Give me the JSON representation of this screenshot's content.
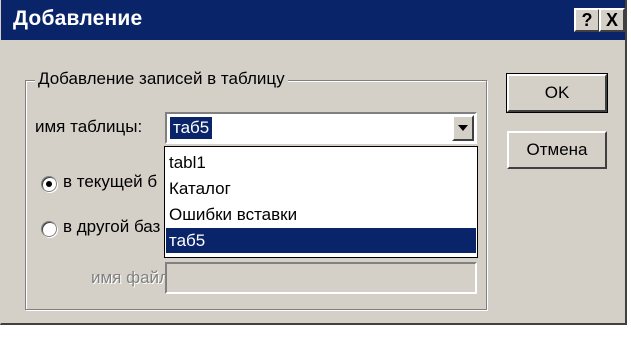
{
  "dialog": {
    "title": "Добавление",
    "help_button": "?",
    "close_button": "X"
  },
  "group": {
    "legend": "Добавление записей в таблицу",
    "table_name_label": "имя таблицы:",
    "table_value": "таб5",
    "radio_current": "в текущей б",
    "radio_other": "в другой баз",
    "file_name_label": "имя файла:"
  },
  "dropdown": {
    "items": [
      "tabl1",
      "Каталог",
      "Ошибки вставки",
      "таб5"
    ],
    "selected_index": 3
  },
  "buttons": {
    "ok": "OK",
    "cancel": "Отмена"
  }
}
